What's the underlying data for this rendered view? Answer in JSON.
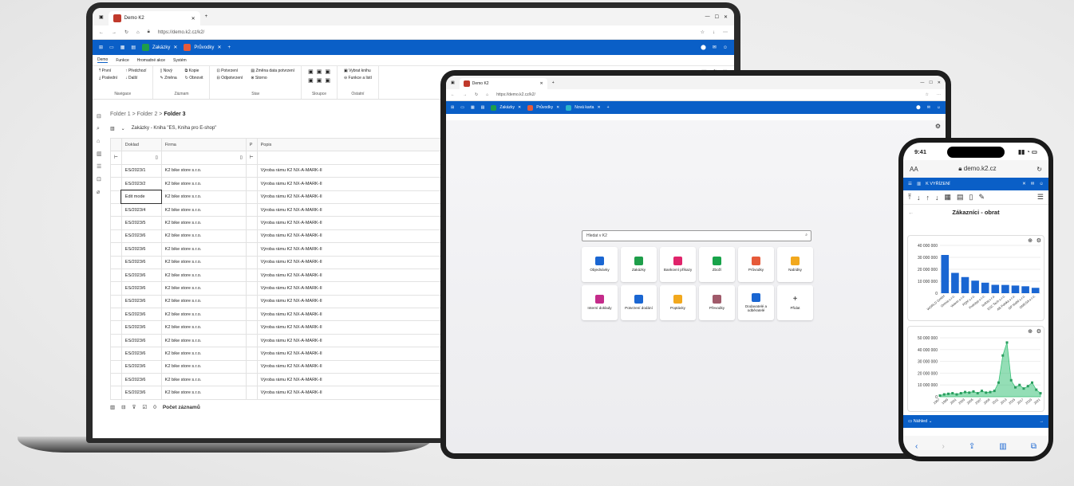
{
  "laptop": {
    "tab_title": "Demo K2",
    "url": "https://demo.k2.cz/k2/",
    "app_tabs": [
      "Zakázky",
      "Průvodky"
    ],
    "ribbon_tabs": [
      "Demo",
      "Funkce",
      "Hromadné akce",
      "Systém"
    ],
    "ribbon_groups": [
      {
        "label": "Navigace",
        "items": [
          "První",
          "Předchozí",
          "Poslední",
          "Další"
        ]
      },
      {
        "label": "Záznam",
        "items": [
          "Nový",
          "Kopie",
          "Změna",
          "Obnovit"
        ]
      },
      {
        "label": "Stav",
        "items": [
          "Potvrzení",
          "Změna data potvrzení",
          "Odpotvrzení",
          "Storno"
        ]
      },
      {
        "label": "Sloupce",
        "items": []
      },
      {
        "label": "Ostatní",
        "items": [
          "Vybrat knihu",
          "Funkce a listí"
        ]
      }
    ],
    "breadcrumb": [
      "Folder 1",
      "Folder 2",
      "Folder 3"
    ],
    "list_title": "Zakázky - Kniha \"ES, Kniha pro E-shop\"",
    "columns": [
      "Doklad",
      "Firma",
      "P",
      "Popis"
    ],
    "rows": [
      [
        "ES/2023/1",
        "K2 bike store s.r.o.",
        "Výroba rámu K2 NX-A-MARK-II"
      ],
      [
        "ES/2023/2",
        "K2 bike store s.r.o.",
        "Výroba rámu K2 NX-A-MARK-II"
      ],
      [
        "Edit mode",
        "K2 bike store s.r.o.",
        "Výroba rámu K2 NX-A-MARK-II"
      ],
      [
        "ES/2023/4",
        "K2 bike store s.r.o.",
        "Výroba rámu K2 NX-A-MARK-II"
      ],
      [
        "ES/2023/5",
        "K2 bike store s.r.o.",
        "Výroba rámu K2 NX-A-MARK-II"
      ],
      [
        "ES/2023/6",
        "K2 bike store s.r.o.",
        "Výroba rámu K2 NX-A-MARK-II"
      ],
      [
        "ES/2023/6",
        "K2 bike store s.r.o.",
        "Výroba rámu K2 NX-A-MARK-II"
      ],
      [
        "ES/2023/6",
        "K2 bike store s.r.o.",
        "Výroba rámu K2 NX-A-MARK-II"
      ],
      [
        "ES/2023/6",
        "K2 bike store s.r.o.",
        "Výroba rámu K2 NX-A-MARK-II"
      ],
      [
        "ES/2023/6",
        "K2 bike store s.r.o.",
        "Výroba rámu K2 NX-A-MARK-II"
      ],
      [
        "ES/2023/6",
        "K2 bike store s.r.o.",
        "Výroba rámu K2 NX-A-MARK-II"
      ],
      [
        "ES/2023/6",
        "K2 bike store s.r.o.",
        "Výroba rámu K2 NX-A-MARK-II"
      ],
      [
        "ES/2023/6",
        "K2 bike store s.r.o.",
        "Výroba rámu K2 NX-A-MARK-II"
      ],
      [
        "ES/2023/6",
        "K2 bike store s.r.o.",
        "Výroba rámu K2 NX-A-MARK-II"
      ],
      [
        "ES/2023/6",
        "K2 bike store s.r.o.",
        "Výroba rámu K2 NX-A-MARK-II"
      ],
      [
        "ES/2023/6",
        "K2 bike store s.r.o.",
        "Výroba rámu K2 NX-A-MARK-II"
      ],
      [
        "ES/2023/6",
        "K2 bike store s.r.o.",
        "Výroba rámu K2 NX-A-MARK-II"
      ],
      [
        "ES/2023/6",
        "K2 bike store s.r.o.",
        "Výroba rámu K2 NX-A-MARK-II"
      ]
    ],
    "status": {
      "count": "0",
      "label": "Počet záznamů"
    }
  },
  "tablet": {
    "tab_title": "Demo K2",
    "url": "https://demo.k2.cz/k2/",
    "app_tabs": [
      "Zakázky",
      "Průvodky",
      "Nová karta"
    ],
    "search_placeholder": "Hledat v K2",
    "tiles": [
      {
        "label": "Objednávky",
        "color": "#1a66d2"
      },
      {
        "label": "Zakázky",
        "color": "#1e9e4a"
      },
      {
        "label": "Bankovní příkazy",
        "color": "#e0246b"
      },
      {
        "label": "Zboží",
        "color": "#18a34a"
      },
      {
        "label": "Průvodky",
        "color": "#e65a3a"
      },
      {
        "label": "Nabídky",
        "color": "#f2a81d"
      },
      {
        "label": "Interní doklady",
        "color": "#c42b8a"
      },
      {
        "label": "Potvrzení dodání",
        "color": "#1a66d2"
      },
      {
        "label": "Poptávky",
        "color": "#f2a81d"
      },
      {
        "label": "Převodky",
        "color": "#a05a6a"
      },
      {
        "label": "Dodavatelé a odběratelé",
        "color": "#1a66d2"
      },
      {
        "label": "Přidat",
        "color": "#ffffff"
      }
    ]
  },
  "phone": {
    "time": "9:41",
    "aa": "AA",
    "url": "demo.k2.cz",
    "section": "K VYŘÍZENÍ",
    "title": "Zákazníci - obrat",
    "footer_label": "Náhled"
  },
  "chart_data": [
    {
      "type": "bar",
      "title": "Zákazníci - obrat",
      "categories": [
        "WORLD GmbH",
        "Omnia s.r.o.",
        "Velonn s.r.o.",
        "PQM s.r.o.",
        "Prototyp s.r.o.",
        "Izoloq s.r.o.",
        "ESC Tech s.r.o.",
        "AB Polska s.r.o.",
        "GP Mobil s.r.o.",
        "OMEGA s.r.o."
      ],
      "values": [
        32000000,
        17000000,
        13500000,
        10500000,
        8800000,
        7000000,
        6900000,
        6400000,
        5800000,
        4500000
      ],
      "ylim": [
        0,
        40000000
      ],
      "yticks": [
        "0",
        "10 000 000",
        "20 000 000",
        "30 000 000",
        "40 000 000"
      ],
      "color": "#1a66d2"
    },
    {
      "type": "area",
      "x": [
        1997,
        1998,
        1999,
        2000,
        2001,
        2002,
        2003,
        2004,
        2005,
        2006,
        2007,
        2008,
        2009,
        2010,
        2011,
        2012,
        2013,
        2014,
        2015,
        2016,
        2017,
        2018,
        2019,
        2020,
        2021
      ],
      "values": [
        1000000,
        2000000,
        2500000,
        3000000,
        2000000,
        3000000,
        4000000,
        3500000,
        4500000,
        3000000,
        5000000,
        3500000,
        4000000,
        5000000,
        12000000,
        35000000,
        46000000,
        14000000,
        8000000,
        10000000,
        7000000,
        9000000,
        12000000,
        6000000,
        3000000
      ],
      "xticks": [
        "1997",
        "1999",
        "2001",
        "2003",
        "2005",
        "2007",
        "2009",
        "2011",
        "2013",
        "2015",
        "2017",
        "2019",
        "2021"
      ],
      "ylim": [
        0,
        50000000
      ],
      "yticks": [
        "0",
        "10 000 000",
        "20 000 000",
        "30 000 000",
        "40 000 000",
        "50 000 000"
      ],
      "color": "#3cc27a"
    }
  ]
}
